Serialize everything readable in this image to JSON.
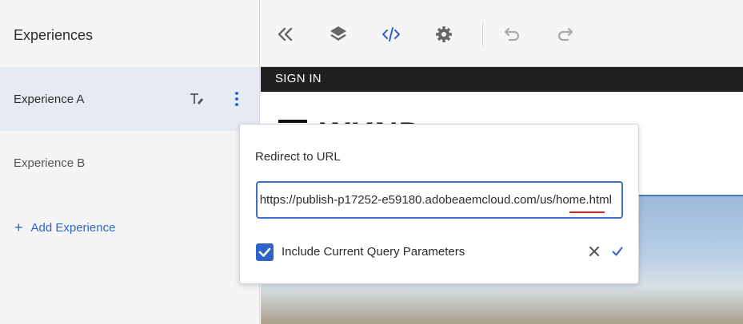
{
  "sidebar": {
    "title": "Experiences",
    "experiences": [
      {
        "label": "Experience A"
      },
      {
        "label": "Experience B"
      }
    ],
    "add_label": "Add Experience"
  },
  "toolbar": {
    "icons": [
      "collapse-icon",
      "layers-icon",
      "code-icon",
      "settings-icon",
      "undo-icon",
      "redo-icon"
    ]
  },
  "preview": {
    "signin": "SIGN IN",
    "logo": "WKND"
  },
  "dialog": {
    "title": "Redirect to URL",
    "url_value": "https://publish-p17252-e59180.adobeaemcloud.com/us/home.html",
    "checkbox_label": "Include Current Query Parameters",
    "checkbox_checked": true
  },
  "colors": {
    "accent": "#2e64c9",
    "selected_row": "#e6ebf3",
    "panel_bg": "#f5f5f5",
    "signin_bar": "#202020",
    "error_underline": "#e0241f"
  }
}
